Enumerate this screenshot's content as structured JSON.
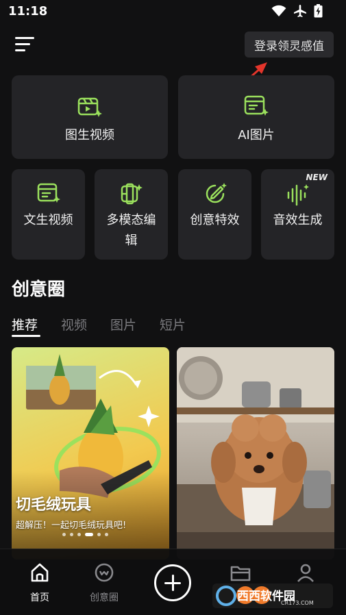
{
  "status_bar": {
    "time": "11:18"
  },
  "header": {
    "login_label": "登录领灵感值"
  },
  "tools": {
    "large": [
      {
        "label": "图生视频",
        "icon": "image-to-video-icon"
      },
      {
        "label": "AI图片",
        "icon": "ai-image-icon"
      }
    ],
    "small": [
      {
        "label": "文生视频",
        "icon": "text-to-video-icon"
      },
      {
        "label": "多模态编辑",
        "icon": "multimodal-edit-icon"
      },
      {
        "label": "创意特效",
        "icon": "creative-effects-icon"
      },
      {
        "label": "音效生成",
        "icon": "sound-effects-icon",
        "badge": "NEW"
      }
    ]
  },
  "feed_section": {
    "title": "创意圈",
    "tabs": [
      "推荐",
      "视频",
      "图片",
      "短片"
    ],
    "active_tab": 0,
    "cards": [
      {
        "title": "切毛绒玩具",
        "subtitle": "超解压！一起切毛绒玩具吧!",
        "dots": 6,
        "active_dot": 3
      },
      {
        "title": "",
        "subtitle": ""
      }
    ]
  },
  "bottom_nav": {
    "items": [
      {
        "label": "首页",
        "icon": "home-icon",
        "active": true
      },
      {
        "label": "创意圈",
        "icon": "creative-circle-icon",
        "active": false
      },
      {
        "label": "",
        "icon": "plus-icon",
        "active": false
      },
      {
        "label": "",
        "icon": "folder-icon",
        "active": false
      },
      {
        "label": "",
        "icon": "profile-icon",
        "active": false
      }
    ]
  },
  "colors": {
    "accent_green": "#9be15d",
    "card_bg": "#242427",
    "background": "#111112"
  },
  "watermark": {
    "text": "西西软件园",
    "sub": "CR173.COM"
  }
}
